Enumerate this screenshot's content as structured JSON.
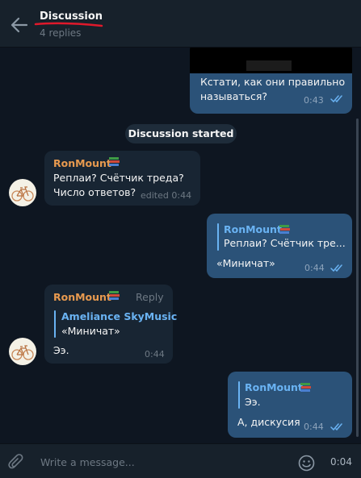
{
  "header": {
    "title": "Discussion",
    "subtitle": "4 replies"
  },
  "messages": [
    {
      "direction": "out",
      "text_lines": [
        "Кстати, как они правильно",
        "называться?"
      ],
      "time": "0:43",
      "status": "read"
    },
    {
      "direction": "in",
      "sender": "RonMount",
      "text_lines": [
        "Реплаи? Счётчик треда?",
        "Число ответов?"
      ],
      "time": "edited 0:44"
    },
    {
      "direction": "out",
      "quote": {
        "name": "RonMount",
        "text": "Реплаи? Счётчик тре..."
      },
      "text_lines": [
        "«Миничат»"
      ],
      "time": "0:44",
      "status": "read"
    },
    {
      "direction": "in",
      "sender": "RonMount",
      "reply_label": "Reply",
      "quote": {
        "name": "Ameliance SkyMusic",
        "text": "«Миничат»"
      },
      "text_lines": [
        "Ээ."
      ],
      "time": "0:44"
    },
    {
      "direction": "out",
      "quote": {
        "name": "RonMount",
        "text": "Ээ."
      },
      "text_lines": [
        "А, дискусия"
      ],
      "time": "0:44",
      "status": "read"
    }
  ],
  "service_message": "Discussion started",
  "composer": {
    "placeholder": "Write a message...",
    "timer": "0:04"
  },
  "colors": {
    "background": "#0e1621",
    "panel": "#17212b",
    "bubble_out": "#2b5278",
    "bubble_in": "#182533",
    "sender_name": "#e89a4f",
    "accent": "#6ab3f3",
    "annotation_underline": "#e0192b"
  },
  "icons": [
    "back-arrow-icon",
    "book-icon",
    "double-check-icon",
    "attach-icon",
    "emoji-icon",
    "bicycle-avatar"
  ]
}
